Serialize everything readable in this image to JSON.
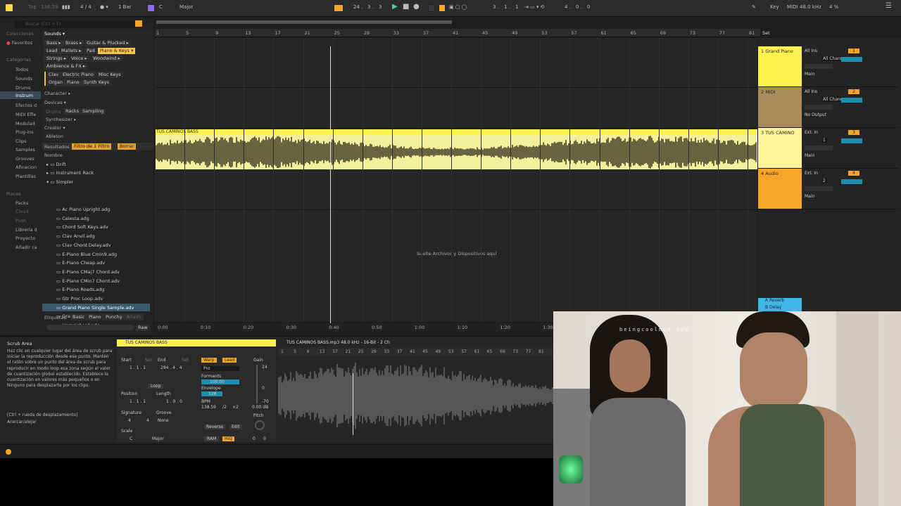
{
  "top": {
    "tap": "Tap",
    "tempo": "138.59",
    "sig": "4 / 4",
    "quant": "1 Bar",
    "key": "C",
    "scale": "Major",
    "pos1": "24 .",
    "pos2": "3 .",
    "pos3": "3",
    "loop1": "3 .",
    "loop2": "1 .",
    "loop3": "1",
    "len1": "4 .",
    "len2": "0 .",
    "len3": "0",
    "keyl": "Key",
    "midil": "MIDI",
    "rate": "48.0 kHz",
    "cpu": "4 %"
  },
  "browser": {
    "search": "Buscar (Ctrl + F)",
    "colecciones": "Colecciones",
    "favoritos": "Favoritos",
    "categorias": "Categorías",
    "todos": "Todos",
    "sounds": "Sounds",
    "drums": "Drums",
    "instrum": "Instrum",
    "efectos": "Efectos d",
    "midieff": "MIDI Effe",
    "modul": "Modulad",
    "plugins": "Plug-ins",
    "clips": "Clips",
    "samples": "Samples",
    "grooves": "Grooves",
    "afinacion": "Afinacion",
    "plantillas": "Plantillas",
    "places": "Places",
    "packs": "Packs",
    "cloud": "Cloud",
    "push": "Push",
    "libreria": "Librería d",
    "proyecto": "Proyecto",
    "anadir": "Añadir ca",
    "soundsHdr": "Sounds ▾",
    "chips": [
      "Bass ▸",
      "Brass ▸",
      "Guitar & Plucked ▸",
      "Lead",
      "Mallets ▸",
      "Pad",
      "Piano & Keys ▾",
      "Strings ▸",
      "Voice ▸",
      "Woodwind ▸",
      "Ambience & FX ▸",
      "Clav",
      "Electric Piano",
      "Misc Keys",
      "Organ",
      "Piano",
      "Synth Keys"
    ],
    "character": "Character ▸",
    "devices": "Devices ▾",
    "drumsD": "Drums",
    "racks": "Racks",
    "sampling": "Sampling",
    "synth": "Synthesizer ▸",
    "creator": "Creator ▾",
    "ableton": "Ableton",
    "resultados": "Resultados",
    "filtro": "Filtro de 1 Filtro",
    "borrar": "Borrar",
    "nombre": "Nombre",
    "folders": [
      "Drift",
      "Instrument Rack",
      "Simpler"
    ],
    "files": [
      "Ac Piano Upright.adg",
      "Celesta.adg",
      "Chord Soft Keys.adv",
      "Clav Anvil.adg",
      "Clav Chord Delay.adv",
      "E-Piano Blue Cmin9.adg",
      "E-Piano Cheap.adv",
      "E-Piano CMaj7 Chord.adv",
      "E-Piano CMin7 Chord.adv",
      "E-Piano Roads.adg",
      "Gtr Proc Loop.adv",
      "Grand Piano Single Sample.adv",
      "Grand Piano.adg",
      "Harpsichord.adg"
    ],
    "etiquetas": "Etiquetas:",
    "tags": [
      "Basic",
      "Piano",
      "Punchy",
      "Añadir"
    ],
    "raw": "Raw"
  },
  "ruler": [
    "1",
    "5",
    "9",
    "13",
    "17",
    "21",
    "25",
    "29",
    "33",
    "37",
    "41",
    "45",
    "49",
    "53",
    "57",
    "61",
    "65",
    "69",
    "73",
    "77",
    "81"
  ],
  "timeRuler": [
    "0:00",
    "0:10",
    "0:20",
    "0:30",
    "0:40",
    "0:50",
    "1:00",
    "1:10",
    "1:20",
    "1:30"
  ],
  "clipName": "TUS CAMINOS BASS",
  "drop": "Suelte Archivos y Dispositivos aquí",
  "tracks": [
    {
      "name": "1 Grand Piano",
      "input": "All Ins",
      "chan": "All Channe",
      "out": "Main",
      "num": "1",
      "color": "#fff34d"
    },
    {
      "name": "2 MIDI",
      "input": "All Ins",
      "chan": "All Channe",
      "out": "No Output",
      "num": "2",
      "color": "#a98b5c"
    },
    {
      "name": "3 TUS CAMINO",
      "input": "Ext. In",
      "chan": "1",
      "out": "Main",
      "num": "3",
      "color": "#fff69a"
    },
    {
      "name": "4 Audio",
      "input": "Ext. In",
      "chan": "2",
      "out": "Main",
      "num": "4",
      "color": "#f6a42a"
    }
  ],
  "returns": [
    "A Reverb",
    "B Delay"
  ],
  "set": "Set",
  "info": {
    "title": "Scrub Area",
    "body": "Haz clic en cualquier lugar del área de scrub para iniciar la reproducción desde ese punto. Mantén el ratón sobre un punto del área de scrub para reproducir en modo loop esa zona según el valor de cuantización global establecido. Establece la cuantización en valores más pequeños o en Ninguno para desplazarte por los clips.",
    "hint1": "[Ctrl + rueda de desplazamiento]",
    "hint2": "Acercar/alejar"
  },
  "clip": {
    "name": "TUS CAMINOS BASS",
    "file": "TUS CAMINOS BASS.mp3  48.0 kHz - 16-Bit - 2 Ch",
    "start": "Start",
    "end": "End",
    "set": "Set",
    "s1": "1 .  1 .  1",
    "e1": "294 .  4 .  4",
    "loop": "Loop",
    "position": "Position",
    "length": "Length",
    "p1": "1 .  1 .  1",
    "l1": "1 .  0 .  0",
    "signature": "Signature",
    "groove": "Groove",
    "sig1": "4",
    "sig2": "4",
    "gnone": "None",
    "scale": "Scale",
    "key": "C",
    "mode": "Major",
    "warp": "Warp",
    "lead": "Lead",
    "pro": "Pro",
    "formants": "Formants",
    "fval": "100.00",
    "envelope": "Envelope",
    "eval": "128",
    "bpm": "BPM",
    "bval": "138.59",
    "half": "/2",
    "dbl": "×2",
    "gain": "Gain",
    "gval": "0.00 dB",
    "pitch": "Pitch",
    "pval": "0",
    "cval": "0",
    "reverse": "Reverse",
    "edit": "Edit",
    "ram": "RAM",
    "hiq": "HiQ",
    "db24": "24",
    "db0": "0",
    "db70": "-70",
    "dr": [
      "1",
      "5",
      "9",
      "13",
      "17",
      "21",
      "25",
      "29",
      "33",
      "37",
      "41",
      "45",
      "49",
      "53",
      "57",
      "61",
      "65",
      "69",
      "73",
      "77",
      "81"
    ]
  },
  "webcam": {
    "watermark": "beingcoolmom.app"
  }
}
